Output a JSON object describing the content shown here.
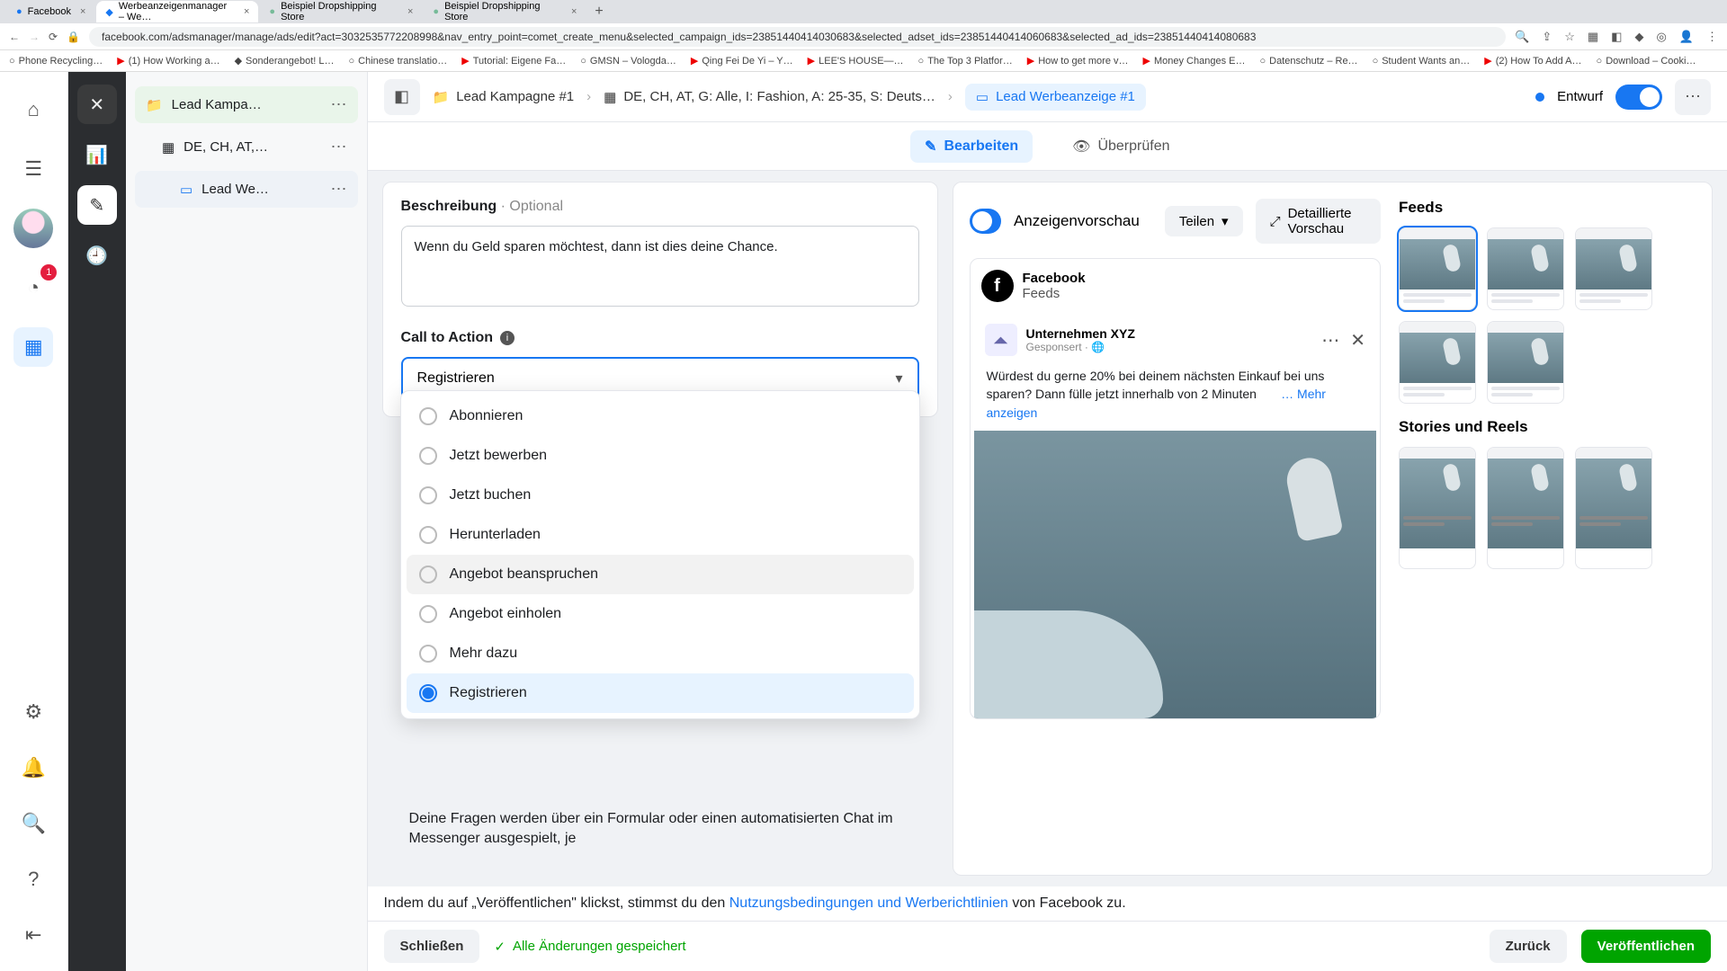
{
  "browser": {
    "tabs": [
      {
        "title": "Facebook"
      },
      {
        "title": "Werbeanzeigenmanager – We…"
      },
      {
        "title": "Beispiel Dropshipping Store"
      },
      {
        "title": "Beispiel Dropshipping Store"
      }
    ],
    "url": "facebook.com/adsmanager/manage/ads/edit?act=3032535772208998&nav_entry_point=comet_create_menu&selected_campaign_ids=23851440414030683&selected_adset_ids=23851440414060683&selected_ad_ids=23851440414080683",
    "bookmarks": [
      "Phone Recycling…",
      "(1) How Working a…",
      "Sonderangebot! L…",
      "Chinese translatio…",
      "Tutorial: Eigene Fa…",
      "GMSN – Vologda…",
      "Qing Fei De Yi – Y…",
      "LEE'S HOUSE—…",
      "The Top 3 Platfor…",
      "How to get more v…",
      "Money Changes E…",
      "Datenschutz – Re…",
      "Student Wants an…",
      "(2) How To Add A…",
      "Download – Cooki…"
    ]
  },
  "tree": {
    "campaign": "Lead Kampa…",
    "adset": "DE, CH, AT,…",
    "ad": "Lead We…"
  },
  "crumbs": {
    "campaign": "Lead Kampagne #1",
    "adset": "DE, CH, AT, G: Alle, I: Fashion, A: 25-35, S: Deuts…",
    "ad": "Lead Werbeanzeige #1",
    "status": "Entwurf"
  },
  "tabs": {
    "edit": "Bearbeiten",
    "review": "Überprüfen"
  },
  "form": {
    "desc_label": "Beschreibung",
    "optional": "· Optional",
    "desc_value": "Wenn du Geld sparen möchtest, dann ist dies deine Chance.",
    "cta_label": "Call to Action",
    "cta_selected": "Registrieren",
    "cta_options": [
      "Abonnieren",
      "Jetzt bewerben",
      "Jetzt buchen",
      "Herunterladen",
      "Angebot beanspruchen",
      "Angebot einholen",
      "Mehr dazu",
      "Registrieren"
    ],
    "below": "Deine Fragen werden über ein Formular oder einen automatisierten Chat im Messenger ausgespielt, je"
  },
  "preview": {
    "title": "Anzeigenvorschau",
    "share": "Teilen",
    "detail": "Detaillierte Vorschau",
    "fb": "Facebook",
    "feeds": "Feeds",
    "company": "Unternehmen XYZ",
    "sponsored": "Gesponsert ·",
    "post_text": "Würdest du gerne 20% bei deinem nächsten Einkauf bei uns sparen? Dann fülle jetzt innerhalb von 2 Minuten",
    "more": "… Mehr anzeigen",
    "placements_feeds": "Feeds",
    "placements_stories": "Stories und Reels"
  },
  "terms": {
    "pre": "Indem du auf „Veröffentlichen\" klickst, stimmst du den ",
    "link": "Nutzungsbedingungen und Werberichtlinien",
    "post": " von Facebook zu."
  },
  "footer": {
    "close": "Schließen",
    "saved": "Alle Änderungen gespeichert",
    "back": "Zurück",
    "publish": "Veröffentlichen"
  },
  "badge": "1"
}
